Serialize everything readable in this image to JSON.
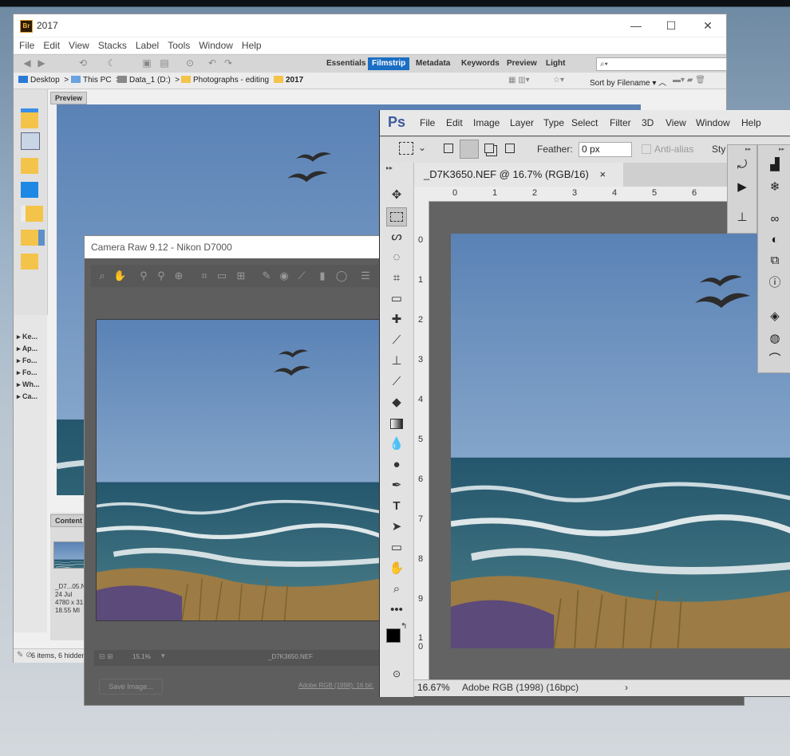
{
  "bridge": {
    "title": "2017",
    "logo_text": "Br",
    "menu": [
      "File",
      "Edit",
      "View",
      "Stacks",
      "Label",
      "Tools",
      "Window",
      "Help"
    ],
    "workspaces": [
      "Essentials",
      "Filmstrip",
      "Metadata",
      "Keywords",
      "Preview",
      "Light"
    ],
    "active_workspace": "Filmstrip",
    "search_placeholder": "⌕▾",
    "path": [
      "Desktop",
      "This PC",
      "Data_1 (D:)",
      "Photographs - editing",
      "2017"
    ],
    "sort_label": "Sort by Filename",
    "preview_tab": "Preview",
    "content_tab": "Content",
    "keyword_panels": [
      "Ke...",
      "Ap...",
      "Fo...",
      "Fo...",
      "Wh...",
      "Ca..."
    ],
    "thumb_meta": [
      "_D7...05.N",
      "24 Jul",
      "4780 x 31",
      "18.55 MI"
    ],
    "status": "6 items, 6 hidden"
  },
  "camera_raw": {
    "title": "Camera Raw 9.12  -  Nikon D7000",
    "zoom": "15.1%",
    "filename": "_D7K3650.NEF",
    "save_button": "Save Image...",
    "workflow": "Adobe RGB (1998); 16 bit;"
  },
  "photoshop": {
    "logo": "Ps",
    "menu": [
      "File",
      "Edit",
      "Image",
      "Layer",
      "Type",
      "Select",
      "Filter",
      "3D",
      "View",
      "Window",
      "Help"
    ],
    "feather_label": "Feather:",
    "feather_value": "0 px",
    "antialias_label": "Anti-alias",
    "style_label": "Sty",
    "doc_tab": "_D7K3650.NEF @ 16.7% (RGB/16)",
    "doc_tab_close": "×",
    "ruler_top": [
      "0",
      "1",
      "2",
      "3",
      "4",
      "5",
      "6"
    ],
    "ruler_left": [
      "0",
      "1",
      "2",
      "3",
      "4",
      "5",
      "6",
      "7",
      "8",
      "9",
      "1\n0"
    ],
    "status_zoom": "16.67%",
    "status_profile": "Adobe RGB (1998) (16bpc)",
    "status_arrow": "›"
  },
  "colors": {
    "bridge_accent": "#1a6ec4",
    "ps_blue": "#3d5a9e",
    "sky": "#5f87b8",
    "sea": "#2e5f74"
  }
}
